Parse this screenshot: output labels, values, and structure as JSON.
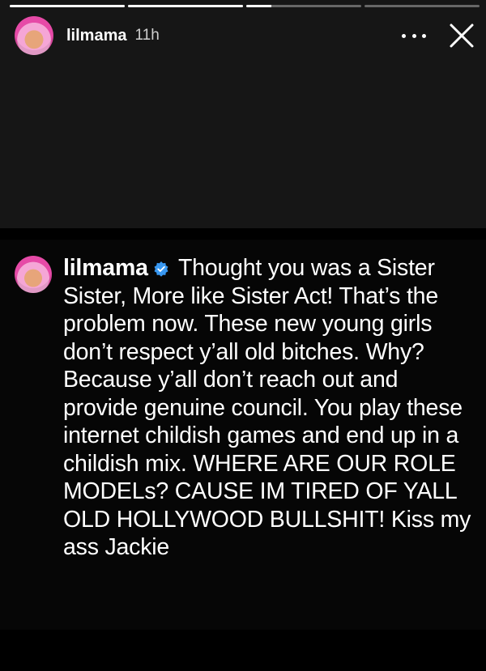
{
  "story": {
    "progress": [
      1,
      1,
      0.22,
      0
    ],
    "header": {
      "username": "lilmama",
      "time": "11h"
    },
    "icons": {
      "more": "more-horizontal-icon",
      "close": "close-icon"
    }
  },
  "comment": {
    "username": "lilmama",
    "verified_icon": "verified-badge-icon",
    "text": " Thought you was a Sister Sister, More like Sister Act! That’s the problem now. These new young girls don’t respect y’all old bitches. Why? Because y’all don’t reach out and provide genuine council. You play these internet childish games and end up in a childish mix. WHERE ARE OUR ROLE MODELs? CAUSE IM TIRED OF YALL OLD HOLLYWOOD BULLSHIT! Kiss my ass Jackie"
  },
  "colors": {
    "background": "#000000",
    "story_area": "#161616",
    "text": "#ffffff",
    "verified": "#3897f0"
  }
}
